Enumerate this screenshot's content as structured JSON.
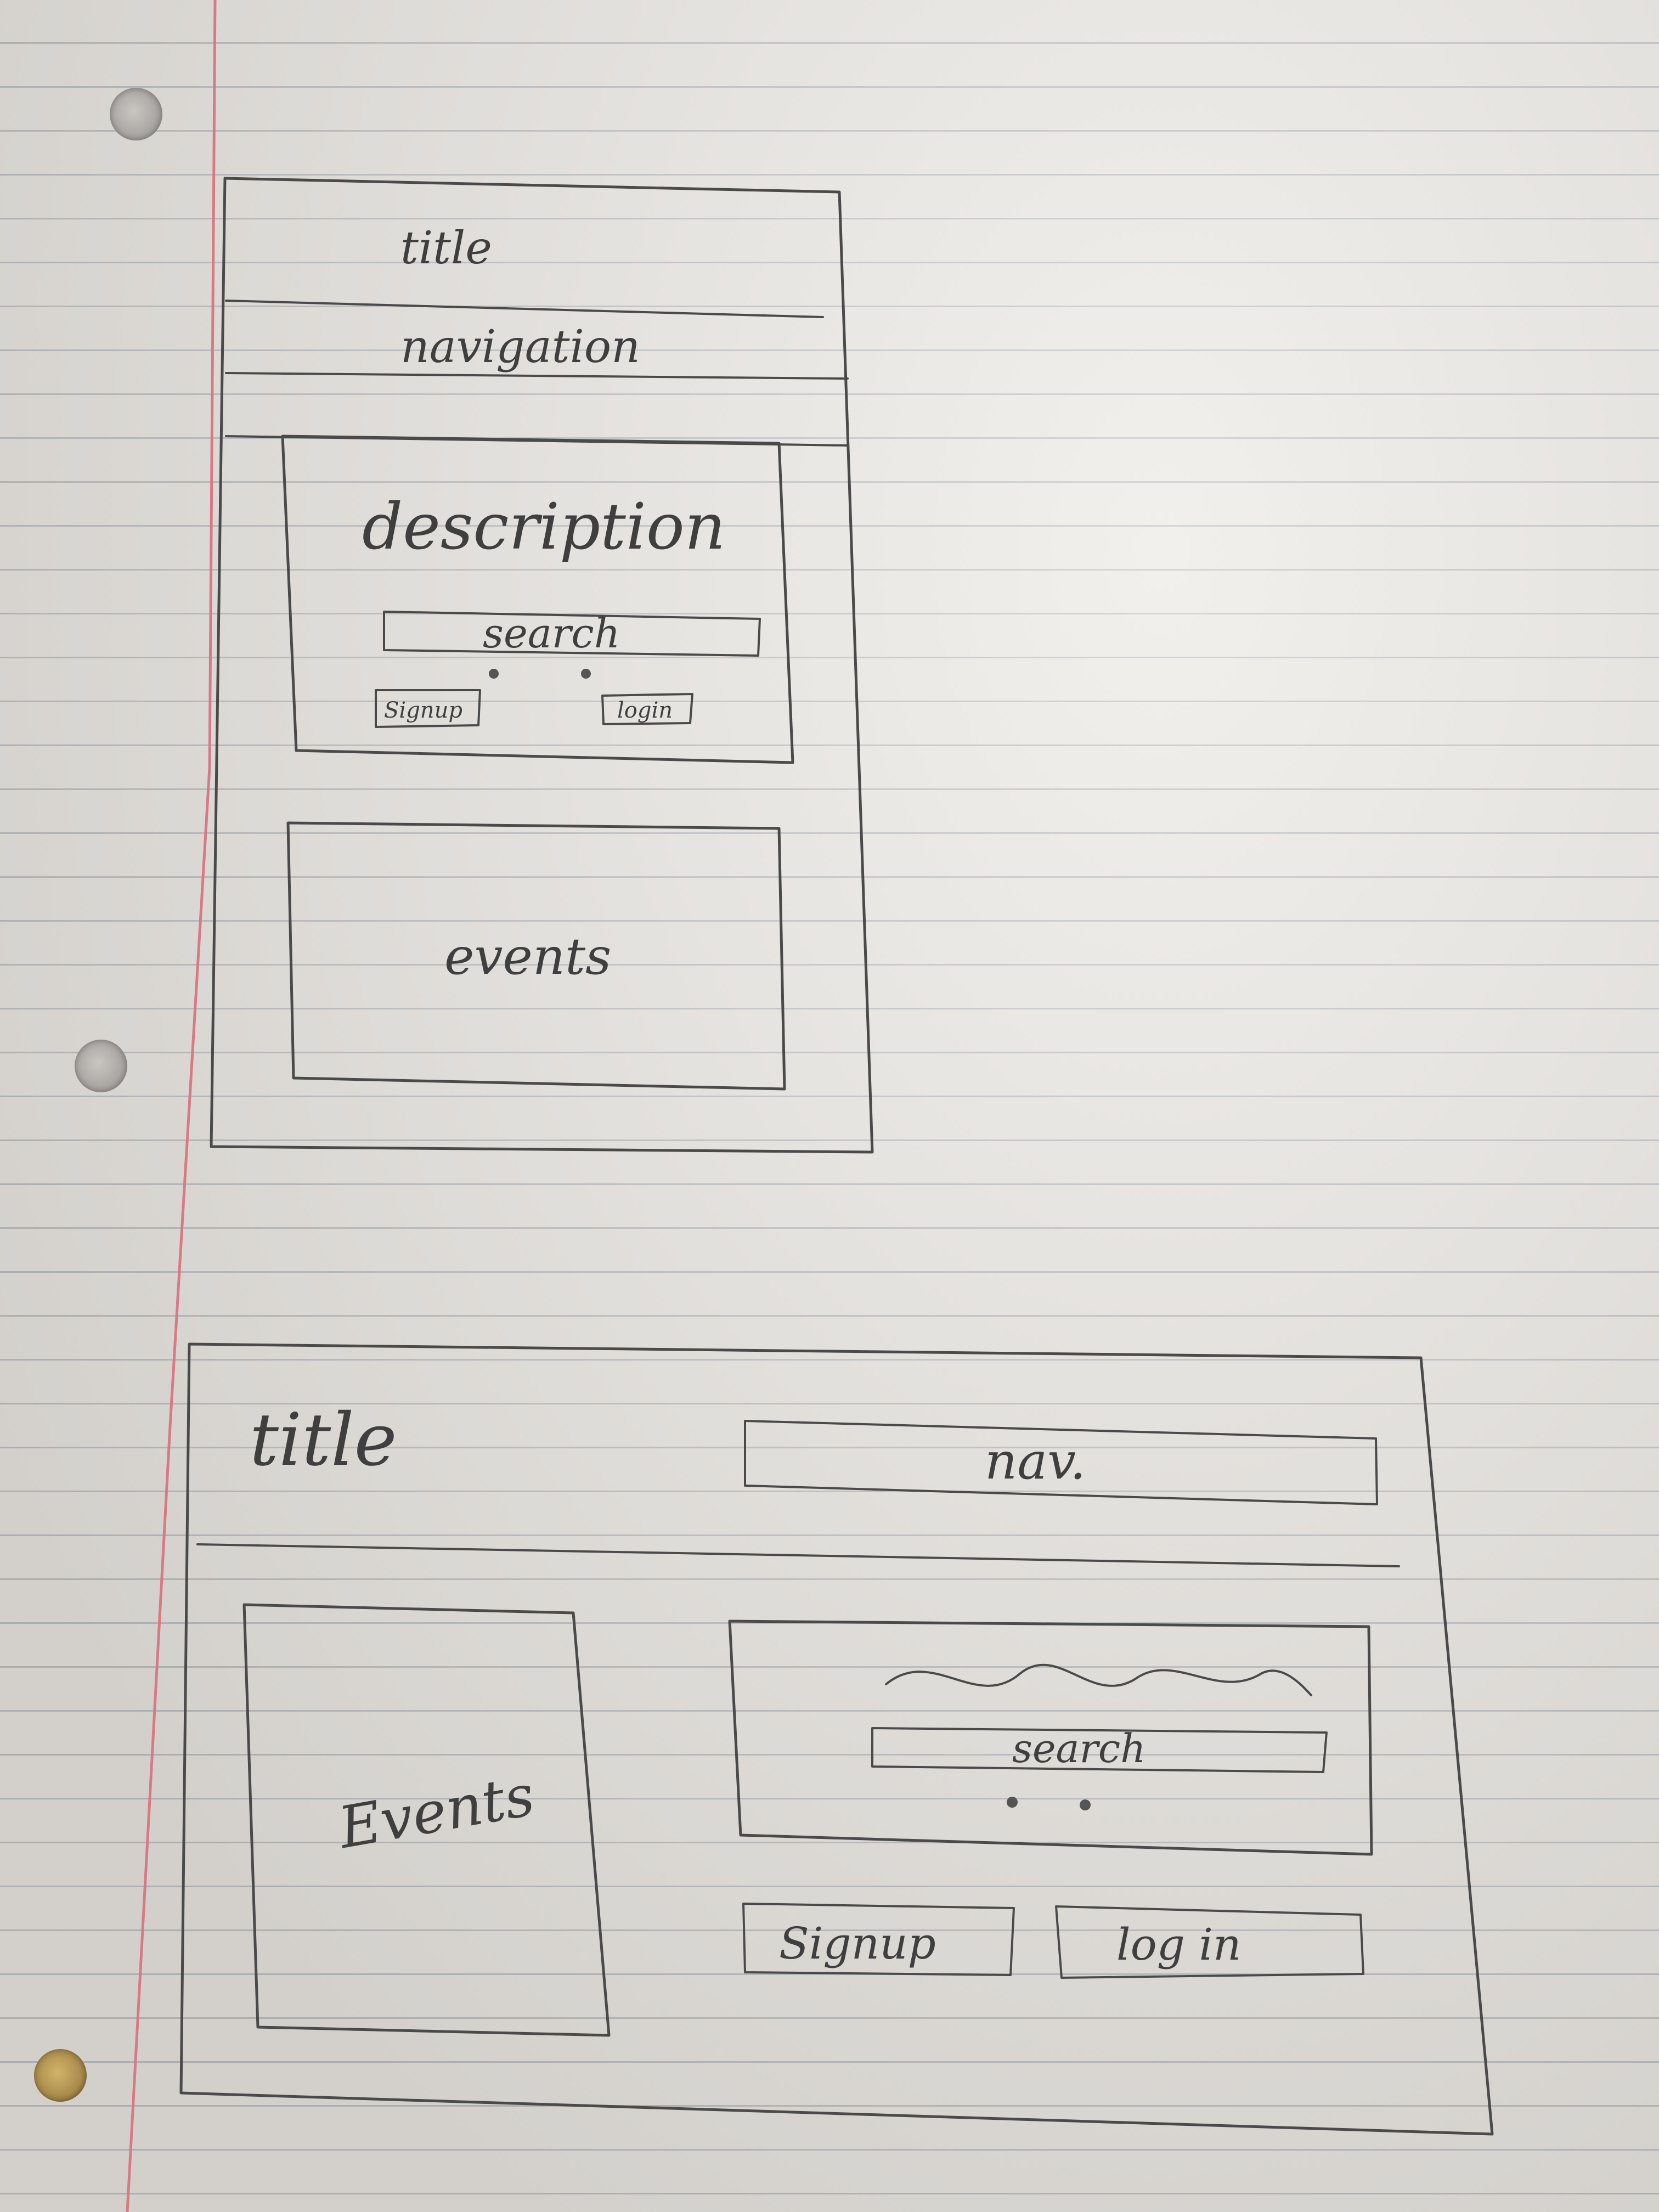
{
  "sketch1": {
    "title": "title",
    "navigation": "navigation",
    "description": "description",
    "search": "search",
    "signup": "Signup",
    "login": "login",
    "events": "events"
  },
  "sketch2": {
    "title": "title",
    "nav": "nav.",
    "search": "search",
    "events": "Events",
    "signup": "Signup",
    "login": "log in"
  }
}
